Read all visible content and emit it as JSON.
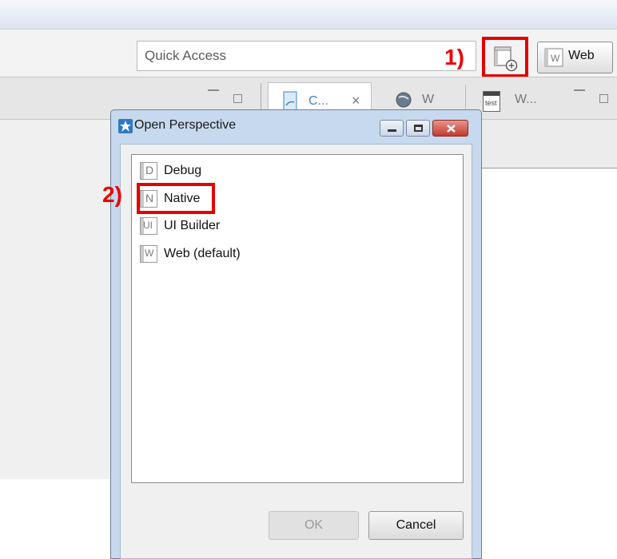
{
  "toolbar": {
    "quick_access_placeholder": "Quick Access",
    "web_perspective_label": "Web",
    "annotation_1": "1)"
  },
  "tabs": [
    {
      "label": "C...",
      "close": "×"
    },
    {
      "label": "W"
    },
    {
      "label": "W...",
      "icon_text": "test"
    }
  ],
  "dialog": {
    "title": "Open Perspective",
    "annotation_2": "2)",
    "items": [
      {
        "icon_letter": "D",
        "label": "Debug"
      },
      {
        "icon_letter": "N",
        "label": "Native"
      },
      {
        "icon_letter": "UI",
        "label": "UI Builder"
      },
      {
        "icon_letter": "W",
        "label": "Web (default)"
      }
    ],
    "ok_label": "OK",
    "cancel_label": "Cancel"
  },
  "colors": {
    "annotation_red": "#e30000",
    "dialog_frame": "#c7d9ee",
    "close_button": "#d9473a"
  }
}
